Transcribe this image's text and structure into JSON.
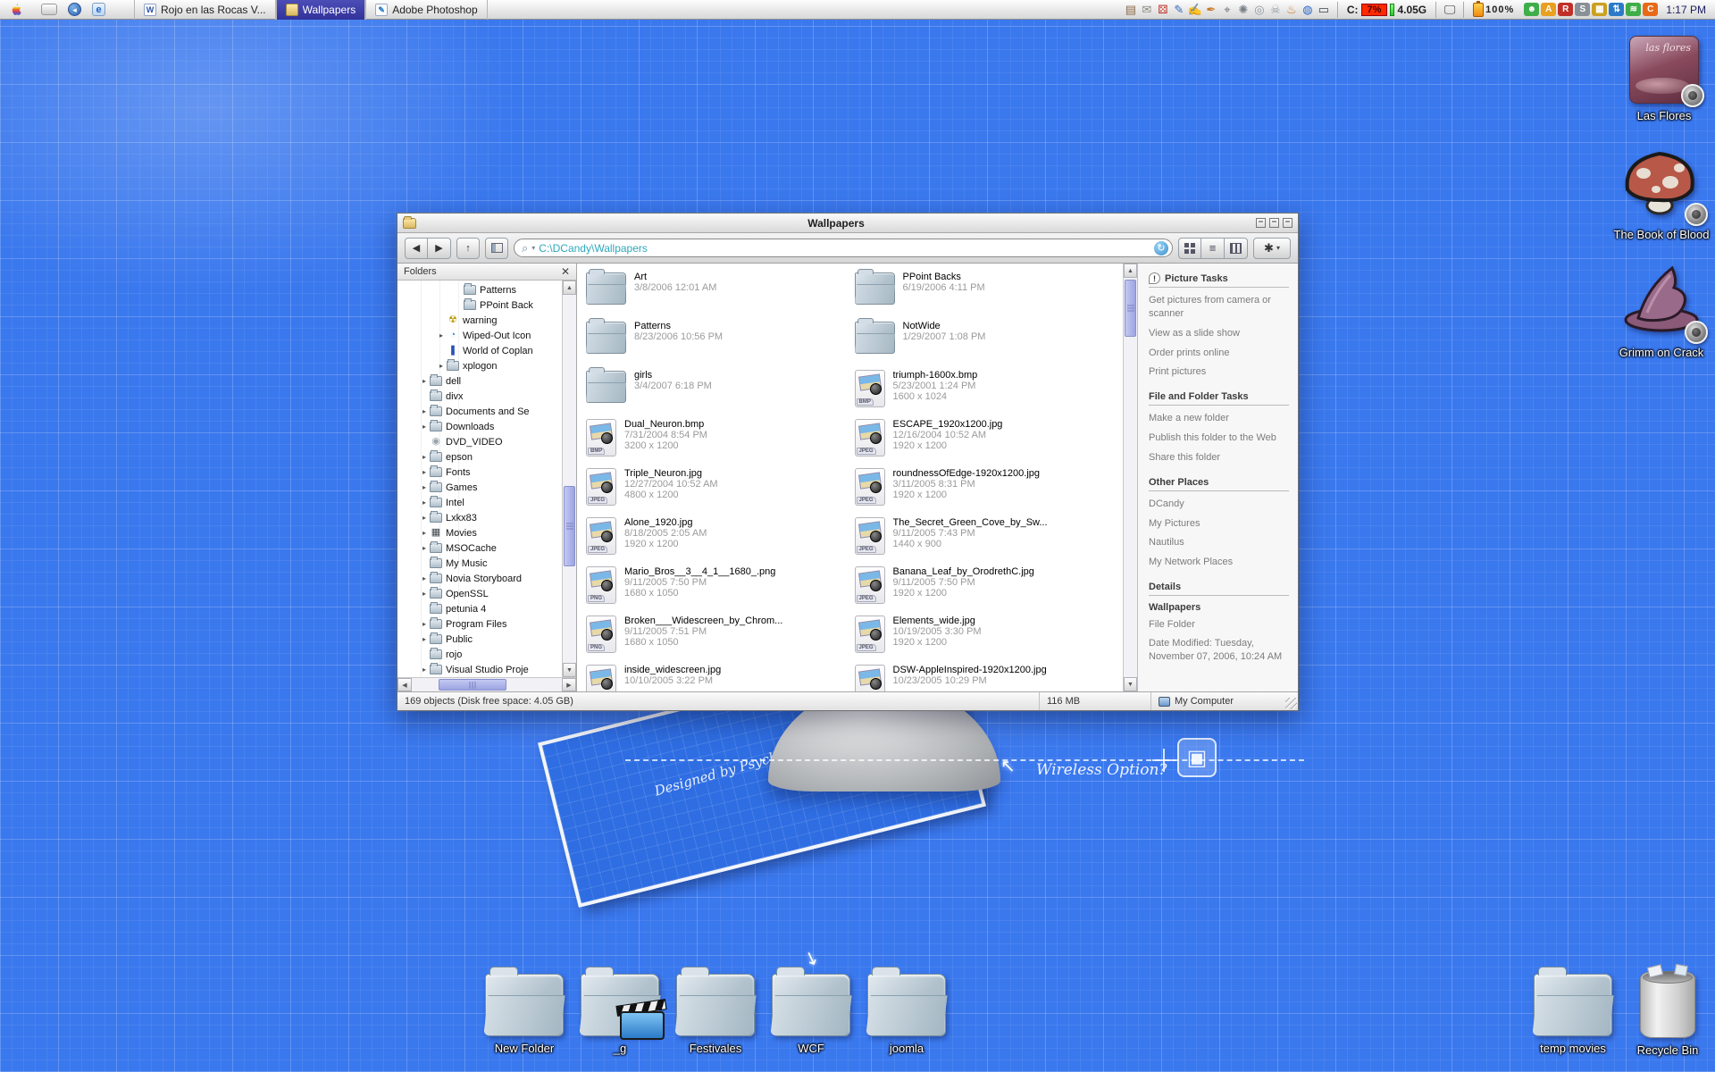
{
  "menubar": {
    "clock": "1:17 PM",
    "tasks": [
      {
        "label": "Rojo en las Rocas V...",
        "icon": "word",
        "active": false
      },
      {
        "label": "Wallpapers",
        "icon": "folder",
        "active": true
      },
      {
        "label": "Adobe Photoshop",
        "icon": "photoshop",
        "active": false
      }
    ],
    "disk": {
      "label": "C:",
      "usage": "7%",
      "free": "4.05G"
    },
    "battery": "100%",
    "tray_icons": [
      "address-book",
      "mail",
      "dice",
      "tablet-pen",
      "notes",
      "pen",
      "binoculars",
      "turbine",
      "disc",
      "skull",
      "torch",
      "globe",
      "laptop"
    ],
    "app_icons": [
      "messenger",
      "aim",
      "realplayer",
      "sygate",
      "color-grid",
      "sync",
      "wifi",
      "cpu"
    ]
  },
  "window": {
    "title": "Wallpapers",
    "address": "C:\\DCandy\\Wallpapers",
    "folders_panel": {
      "title": "Folders",
      "items": [
        {
          "label": "Patterns",
          "icon": "folder",
          "indent": 3,
          "arrow": false
        },
        {
          "label": "PPoint Back",
          "icon": "folder",
          "indent": 3,
          "arrow": false
        },
        {
          "label": "warning",
          "icon": "warning",
          "indent": 2,
          "arrow": false
        },
        {
          "label": "Wiped-Out Icon",
          "icon": "wiped",
          "indent": 2,
          "arrow": true
        },
        {
          "label": "World of Coplan",
          "icon": "book",
          "indent": 2,
          "arrow": false
        },
        {
          "label": "xplogon",
          "icon": "folder",
          "indent": 2,
          "arrow": true
        },
        {
          "label": "dell",
          "icon": "folder",
          "indent": 1,
          "arrow": true
        },
        {
          "label": "divx",
          "icon": "folder",
          "indent": 1,
          "arrow": false
        },
        {
          "label": "Documents and Se",
          "icon": "folder",
          "indent": 1,
          "arrow": true
        },
        {
          "label": "Downloads",
          "icon": "downloads",
          "indent": 1,
          "arrow": true
        },
        {
          "label": "DVD_VIDEO",
          "icon": "disc",
          "indent": 1,
          "arrow": false
        },
        {
          "label": "epson",
          "icon": "folder",
          "indent": 1,
          "arrow": true
        },
        {
          "label": "Fonts",
          "icon": "fonts",
          "indent": 1,
          "arrow": true
        },
        {
          "label": "Games",
          "icon": "folder",
          "indent": 1,
          "arrow": true
        },
        {
          "label": "Intel",
          "icon": "folder",
          "indent": 1,
          "arrow": true
        },
        {
          "label": "Lxkx83",
          "icon": "folder",
          "indent": 1,
          "arrow": true
        },
        {
          "label": "Movies",
          "icon": "movies",
          "indent": 1,
          "arrow": true
        },
        {
          "label": "MSOCache",
          "icon": "folder",
          "indent": 1,
          "arrow": true
        },
        {
          "label": "My Music",
          "icon": "folder",
          "indent": 1,
          "arrow": false
        },
        {
          "label": "Novia Storyboard",
          "icon": "folder",
          "indent": 1,
          "arrow": true
        },
        {
          "label": "OpenSSL",
          "icon": "folder",
          "indent": 1,
          "arrow": true
        },
        {
          "label": "petunia 4",
          "icon": "folder",
          "indent": 1,
          "arrow": false
        },
        {
          "label": "Program Files",
          "icon": "folder",
          "indent": 1,
          "arrow": true
        },
        {
          "label": "Public",
          "icon": "public",
          "indent": 1,
          "arrow": true
        },
        {
          "label": "rojo",
          "icon": "folder",
          "indent": 1,
          "arrow": false
        },
        {
          "label": "Visual Studio Proje",
          "icon": "folder",
          "indent": 1,
          "arrow": true
        }
      ]
    },
    "files": {
      "col1": [
        {
          "name": "Art",
          "date": "3/8/2006 12:01 AM",
          "dims": "",
          "type": "folder"
        },
        {
          "name": "Patterns",
          "date": "8/23/2006 10:56 PM",
          "dims": "",
          "type": "folder"
        },
        {
          "name": "girls",
          "date": "3/4/2007 6:18 PM",
          "dims": "",
          "type": "folder"
        },
        {
          "name": "Dual_Neuron.bmp",
          "date": "7/31/2004 8:54 PM",
          "dims": "3200 x 1200",
          "type": "BMP"
        },
        {
          "name": "Triple_Neuron.jpg",
          "date": "12/27/2004 10:52 AM",
          "dims": "4800 x 1200",
          "type": "JPEG"
        },
        {
          "name": "Alone_1920.jpg",
          "date": "8/18/2005 2:05 AM",
          "dims": "1920 x 1200",
          "type": "JPEG"
        },
        {
          "name": "Mario_Bros__3__4_1__1680_.png",
          "date": "9/11/2005 7:50 PM",
          "dims": "1680 x 1050",
          "type": "PNG"
        },
        {
          "name": "Broken___Widescreen_by_Chrom...",
          "date": "9/11/2005 7:51 PM",
          "dims": "1680 x 1050",
          "type": "PNG"
        },
        {
          "name": "inside_widescreen.jpg",
          "date": "10/10/2005 3:22 PM",
          "dims": "",
          "type": "JPEG"
        }
      ],
      "col2": [
        {
          "name": "PPoint Backs",
          "date": "6/19/2006 4:11 PM",
          "dims": "",
          "type": "folder"
        },
        {
          "name": "NotWide",
          "date": "1/29/2007 1:08 PM",
          "dims": "",
          "type": "folder"
        },
        {
          "name": "triumph-1600x.bmp",
          "date": "5/23/2001 1:24 PM",
          "dims": "1600 x 1024",
          "type": "BMP"
        },
        {
          "name": "ESCAPE_1920x1200.jpg",
          "date": "12/16/2004 10:52 AM",
          "dims": "1920 x 1200",
          "type": "JPEG"
        },
        {
          "name": "roundnessOfEdge-1920x1200.jpg",
          "date": "3/11/2005 8:31 PM",
          "dims": "1920 x 1200",
          "type": "JPEG"
        },
        {
          "name": "The_Secret_Green_Cove_by_Sw...",
          "date": "9/11/2005 7:43 PM",
          "dims": "1440 x 900",
          "type": "JPEG"
        },
        {
          "name": "Banana_Leaf_by_OrodrethC.jpg",
          "date": "9/11/2005 7:50 PM",
          "dims": "1920 x 1200",
          "type": "JPEG"
        },
        {
          "name": "Elements_wide.jpg",
          "date": "10/19/2005 3:30 PM",
          "dims": "1920 x 1200",
          "type": "JPEG"
        },
        {
          "name": "DSW-AppleInspired-1920x1200.jpg",
          "date": "10/23/2005 10:29 PM",
          "dims": "",
          "type": "JPEG"
        }
      ]
    },
    "tasks_panel": {
      "sections": [
        {
          "title": "Picture Tasks",
          "icon": "alert",
          "links": [
            "Get pictures from camera or scanner",
            "View as a slide show",
            "Order prints online",
            "Print pictures"
          ]
        },
        {
          "title": "File and Folder Tasks",
          "links": [
            "Make a new folder",
            "Publish this folder to the Web",
            "Share this folder"
          ]
        },
        {
          "title": "Other Places",
          "links": [
            "DCandy",
            "My Pictures",
            "Nautilus",
            "My Network Places"
          ]
        },
        {
          "title": "Details",
          "details_title": "Wallpapers",
          "details": [
            "File Folder",
            "Date Modified: Tuesday, November 07, 2006, 10:24 AM"
          ]
        }
      ]
    },
    "statusbar": {
      "objects": "169 objects (Disk free space: 4.05 GB)",
      "size": "116 MB",
      "location": "My Computer"
    }
  },
  "desktop": {
    "right_icons": [
      {
        "label": "Las Flores",
        "icon": "album",
        "art_text": "las flores"
      },
      {
        "label": "The Book of Blood",
        "icon": "mushroom"
      },
      {
        "label": "Grimm on Crack",
        "icon": "witch-hat"
      }
    ],
    "bottom_icons": [
      {
        "label": "New Folder",
        "icon": "folder"
      },
      {
        "label": "_g",
        "icon": "movie-folder"
      },
      {
        "label": "Festivales",
        "icon": "folder"
      },
      {
        "label": "WCF",
        "icon": "folder"
      },
      {
        "label": "joomla",
        "icon": "folder"
      }
    ],
    "bottom_right_icons": [
      {
        "label": "temp movies",
        "icon": "folder"
      },
      {
        "label": "Recycle Bin",
        "icon": "trash"
      }
    ],
    "wallpaper_texts": {
      "credit": "Designed by Psychopulse",
      "note": "Wireless Option?"
    }
  }
}
